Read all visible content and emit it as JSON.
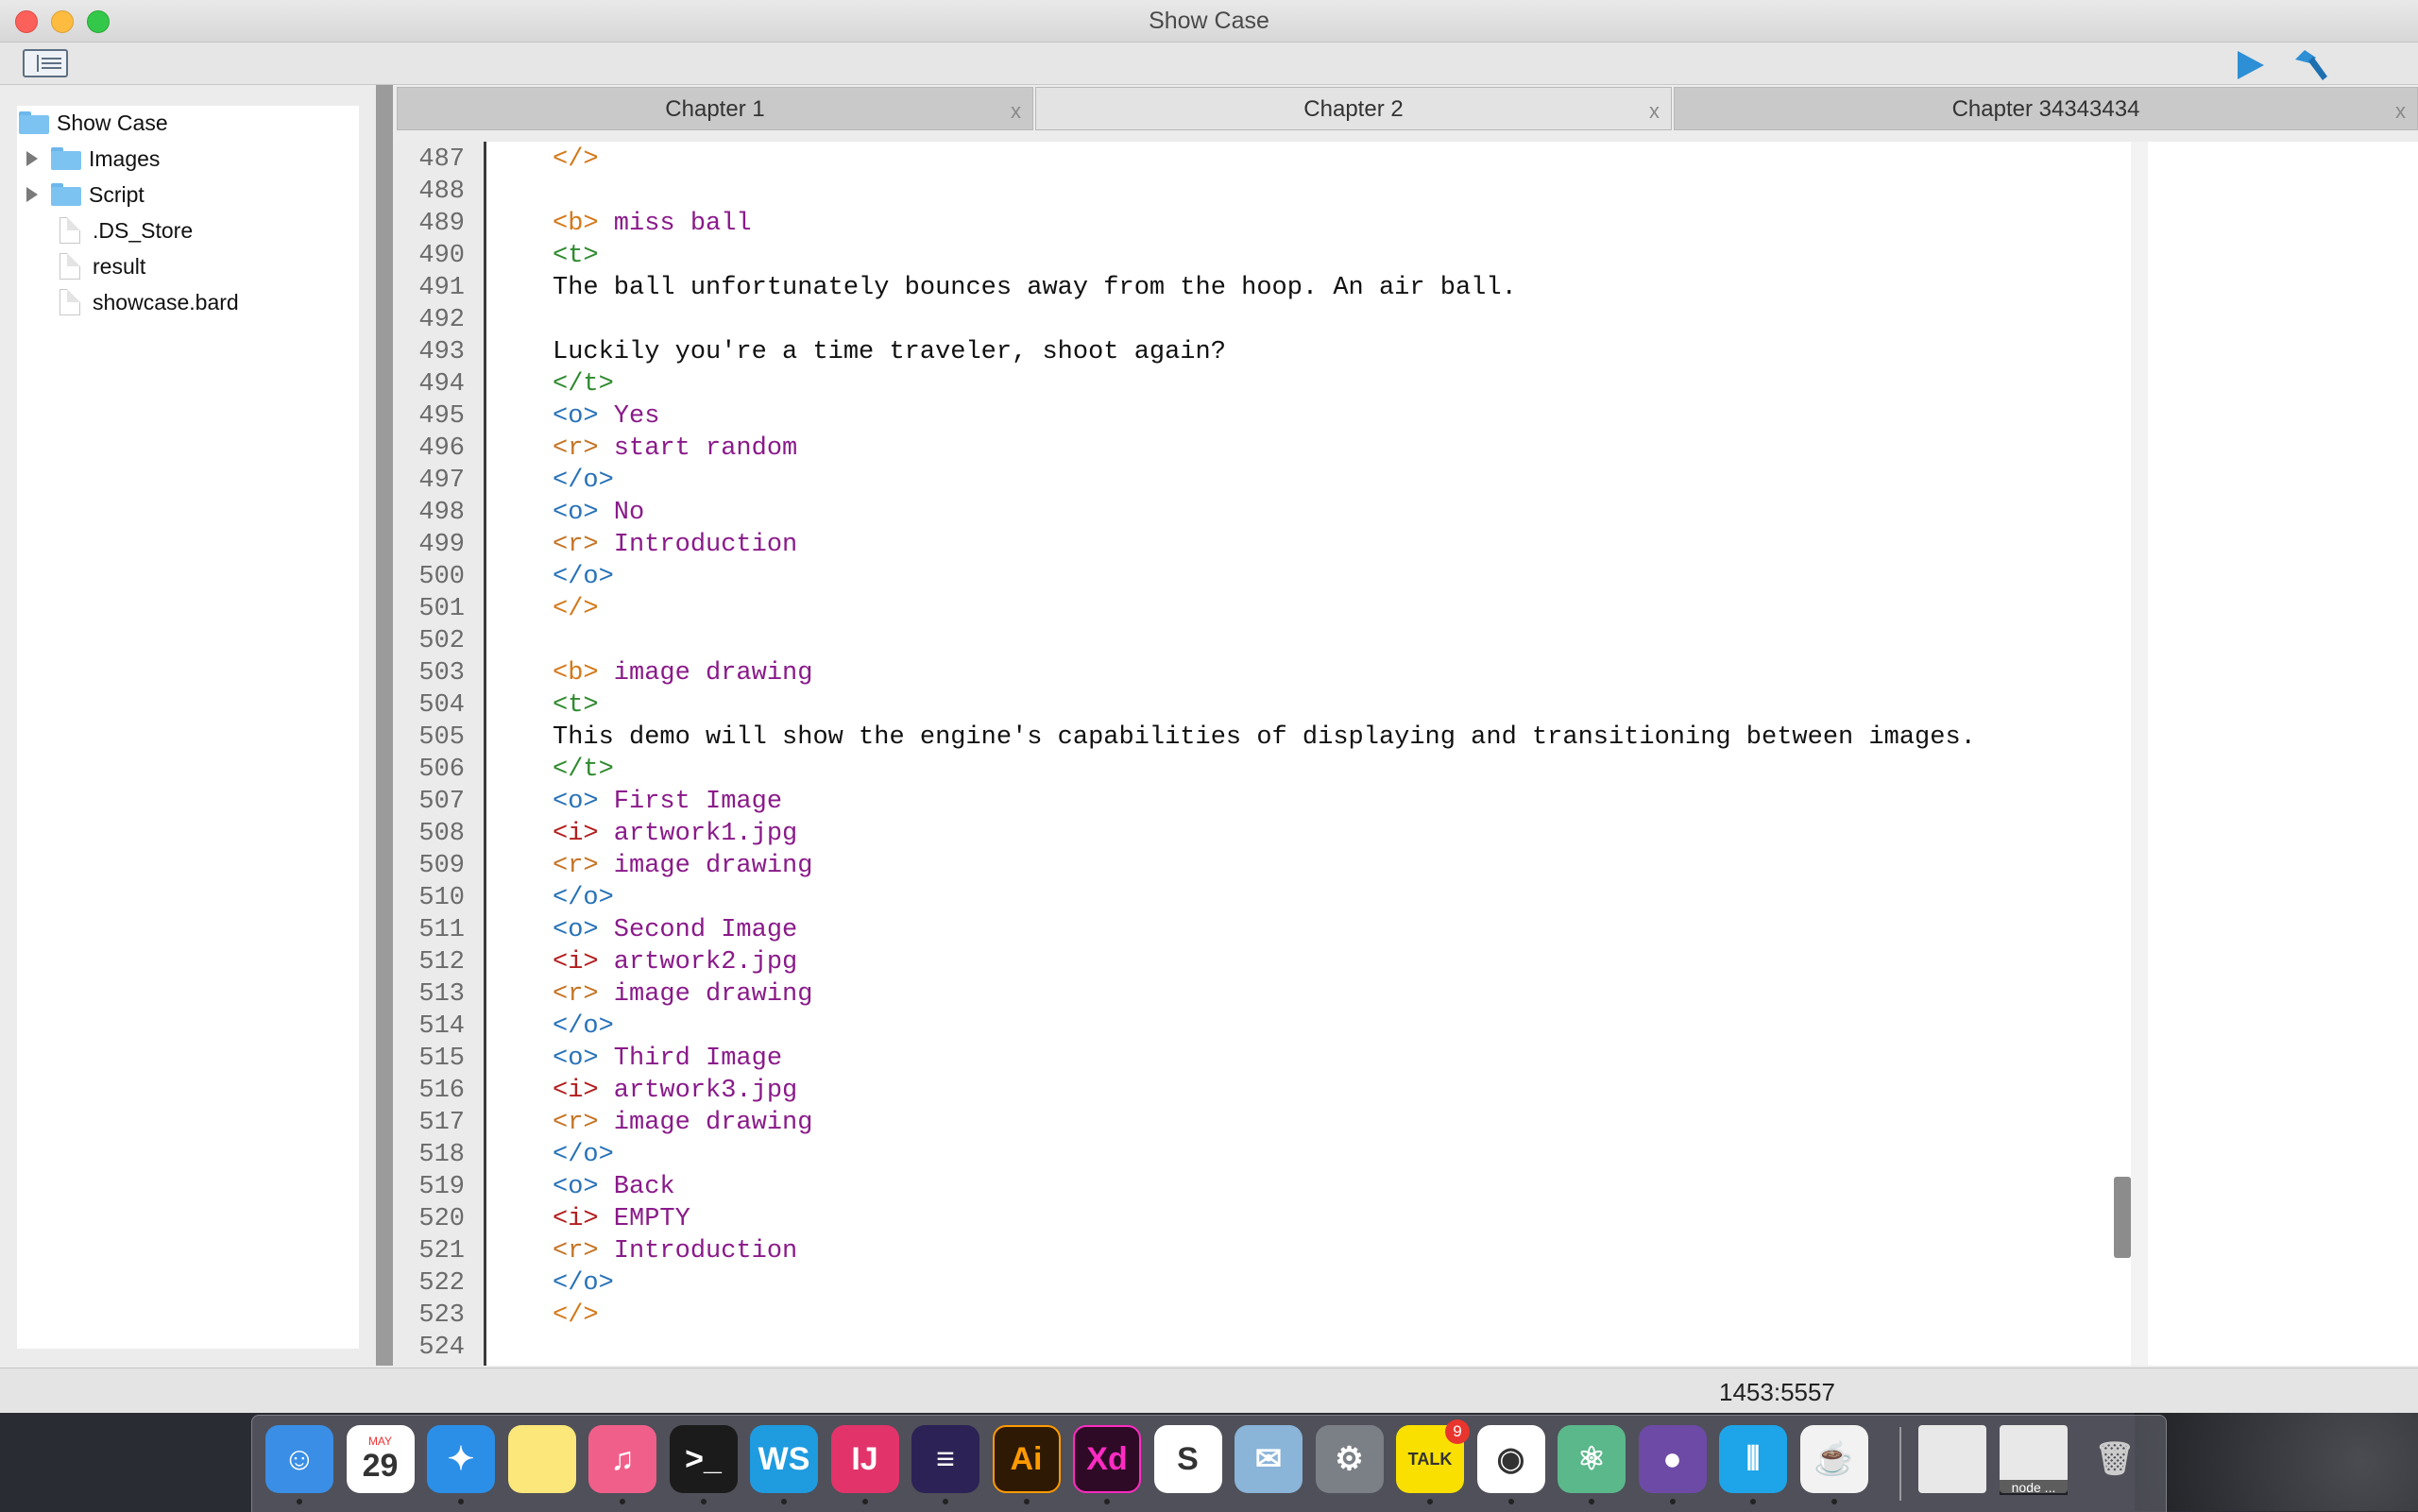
{
  "window": {
    "title": "Show Case"
  },
  "toolbar": {
    "toggle_icon": "sidebar-toggle-icon",
    "run_icon": "run-icon",
    "build_icon": "hammer-icon",
    "accent": "#2d8fd5"
  },
  "tree": {
    "root": "Show Case",
    "items": [
      {
        "label": "Images",
        "type": "folder",
        "expandable": true
      },
      {
        "label": "Script",
        "type": "folder",
        "expandable": true
      },
      {
        "label": ".DS_Store",
        "type": "file"
      },
      {
        "label": "result",
        "type": "file"
      },
      {
        "label": "showcase.bard",
        "type": "file"
      }
    ]
  },
  "tabs": [
    {
      "label": "Chapter 1",
      "close": "x"
    },
    {
      "label": "Chapter 2",
      "close": "x",
      "active": true
    },
    {
      "label": "Chapter 34343434",
      "close": "x"
    }
  ],
  "editor": {
    "lines": [
      {
        "n": "487",
        "tag": "</>",
        "kind": "end",
        "text": ""
      },
      {
        "n": "488",
        "tag": "",
        "kind": "",
        "text": ""
      },
      {
        "n": "489",
        "tag": "<b>",
        "kind": "b",
        "text": " miss ball"
      },
      {
        "n": "490",
        "tag": "<t>",
        "kind": "t",
        "text": ""
      },
      {
        "n": "491",
        "tag": "",
        "kind": "plain",
        "text": "The ball unfortunately bounces away from the hoop. An air ball."
      },
      {
        "n": "492",
        "tag": "",
        "kind": "",
        "text": ""
      },
      {
        "n": "493",
        "tag": "",
        "kind": "plain",
        "text": "Luckily you're a time traveler, shoot again?"
      },
      {
        "n": "494",
        "tag": "</t>",
        "kind": "t",
        "text": ""
      },
      {
        "n": "495",
        "tag": "<o>",
        "kind": "o",
        "text": " Yes"
      },
      {
        "n": "496",
        "tag": "<r>",
        "kind": "r",
        "text": " start random"
      },
      {
        "n": "497",
        "tag": "</o>",
        "kind": "o",
        "text": ""
      },
      {
        "n": "498",
        "tag": "<o>",
        "kind": "o",
        "text": " No"
      },
      {
        "n": "499",
        "tag": "<r>",
        "kind": "r",
        "text": " Introduction"
      },
      {
        "n": "500",
        "tag": "</o>",
        "kind": "o",
        "text": ""
      },
      {
        "n": "501",
        "tag": "</>",
        "kind": "end",
        "text": ""
      },
      {
        "n": "502",
        "tag": "",
        "kind": "",
        "text": ""
      },
      {
        "n": "503",
        "tag": "<b>",
        "kind": "b",
        "text": " image drawing"
      },
      {
        "n": "504",
        "tag": "<t>",
        "kind": "t",
        "text": ""
      },
      {
        "n": "505",
        "tag": "",
        "kind": "plain",
        "text": "This demo will show the engine's capabilities of displaying and transitioning between images."
      },
      {
        "n": "506",
        "tag": "</t>",
        "kind": "t",
        "text": ""
      },
      {
        "n": "507",
        "tag": "<o>",
        "kind": "o",
        "text": " First Image"
      },
      {
        "n": "508",
        "tag": "<i>",
        "kind": "i",
        "text": " artwork1.jpg"
      },
      {
        "n": "509",
        "tag": "<r>",
        "kind": "r",
        "text": " image drawing"
      },
      {
        "n": "510",
        "tag": "</o>",
        "kind": "o",
        "text": ""
      },
      {
        "n": "511",
        "tag": "<o>",
        "kind": "o",
        "text": " Second Image"
      },
      {
        "n": "512",
        "tag": "<i>",
        "kind": "i",
        "text": " artwork2.jpg"
      },
      {
        "n": "513",
        "tag": "<r>",
        "kind": "r",
        "text": " image drawing"
      },
      {
        "n": "514",
        "tag": "</o>",
        "kind": "o",
        "text": ""
      },
      {
        "n": "515",
        "tag": "<o>",
        "kind": "o",
        "text": " Third Image"
      },
      {
        "n": "516",
        "tag": "<i>",
        "kind": "i",
        "text": " artwork3.jpg"
      },
      {
        "n": "517",
        "tag": "<r>",
        "kind": "r",
        "text": " image drawing"
      },
      {
        "n": "518",
        "tag": "</o>",
        "kind": "o",
        "text": ""
      },
      {
        "n": "519",
        "tag": "<o>",
        "kind": "o",
        "text": " Back"
      },
      {
        "n": "520",
        "tag": "<i>",
        "kind": "i",
        "text": " EMPTY"
      },
      {
        "n": "521",
        "tag": "<r>",
        "kind": "r",
        "text": " Introduction"
      },
      {
        "n": "522",
        "tag": "</o>",
        "kind": "o",
        "text": ""
      },
      {
        "n": "523",
        "tag": "</>",
        "kind": "end",
        "text": ""
      },
      {
        "n": "524",
        "tag": "",
        "kind": "",
        "text": ""
      }
    ]
  },
  "status": {
    "cursor": "1453:5557"
  },
  "dock": {
    "apps": [
      {
        "name": "finder",
        "glyph": "☺",
        "bg": "#3a8ee6",
        "running": true
      },
      {
        "name": "calendar",
        "glyph": "29",
        "month": "MAY",
        "bg": "#ffffff"
      },
      {
        "name": "safari",
        "glyph": "✦",
        "bg": "#2b8fe8",
        "running": true
      },
      {
        "name": "notes",
        "glyph": "",
        "bg": "#fbe77a"
      },
      {
        "name": "itunes",
        "glyph": "♫",
        "bg": "#f05f8a",
        "running": true
      },
      {
        "name": "terminal",
        "glyph": ">_",
        "bg": "#1b1b1b",
        "running": true
      },
      {
        "name": "webstorm",
        "glyph": "WS",
        "bg": "#1f9be0",
        "running": true
      },
      {
        "name": "intellij",
        "glyph": "IJ",
        "bg": "#e2336b",
        "running": true
      },
      {
        "name": "eclipse",
        "glyph": "≡",
        "bg": "#2c2255",
        "running": true
      },
      {
        "name": "illustrator",
        "glyph": "Ai",
        "bg": "#2e1a04",
        "running": true
      },
      {
        "name": "adobe-xd",
        "glyph": "Xd",
        "bg": "#2e0a26",
        "running": true
      },
      {
        "name": "slack",
        "glyph": "S",
        "bg": "#ffffff"
      },
      {
        "name": "preview",
        "glyph": "✉",
        "bg": "#8ab4d8"
      },
      {
        "name": "system-preferences",
        "glyph": "⚙",
        "bg": "#7b7f86"
      },
      {
        "name": "kakaotalk",
        "glyph": "TALK",
        "bg": "#f9e000",
        "running": true,
        "badge": "9"
      },
      {
        "name": "chrome",
        "glyph": "◉",
        "bg": "#ffffff",
        "running": true
      },
      {
        "name": "atom",
        "glyph": "⚛",
        "bg": "#5ab88b",
        "running": true
      },
      {
        "name": "github-desktop",
        "glyph": "●",
        "bg": "#6d4aa6",
        "running": true
      },
      {
        "name": "app-store-connect",
        "glyph": "⫴",
        "bg": "#1ea4e8",
        "running": true
      },
      {
        "name": "java",
        "glyph": "☕",
        "bg": "#f2f2f2",
        "running": true
      }
    ],
    "recent": [
      {
        "name": "photo-document",
        "glyph": ""
      },
      {
        "name": "node-window",
        "glyph": "",
        "label": "node ..."
      },
      {
        "name": "trash",
        "glyph": "🗑"
      }
    ]
  }
}
